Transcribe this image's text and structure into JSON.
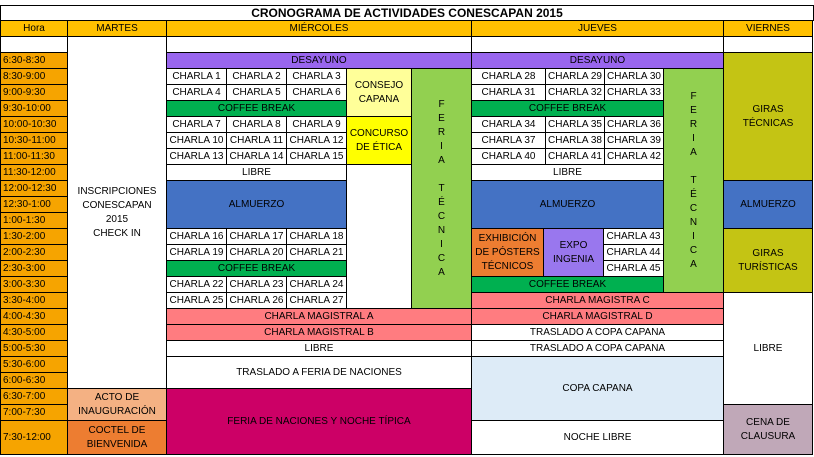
{
  "title": "CRONOGRAMA DE ACTIVIDADES CONESCAPAN 2015",
  "headers": {
    "hora": "Hora",
    "martes": "MARTES",
    "miercoles": "MIÉRCOLES",
    "jueves": "JUEVES",
    "viernes": "VIERNES"
  },
  "hours": [
    "6:30-8:30",
    "8:30-9:00",
    "9:00-9:30",
    "9:30-10:00",
    "10:00-10:30",
    "10:30-11:00",
    "11:00-11:30",
    "11:30-12:00",
    "12:00-12:30",
    "12:30-1:00",
    "1:00-1:30",
    "1:30-2:00",
    "2:00-2:30",
    "2:30-3:00",
    "3:00-3:30",
    "3:30-4:00",
    "4:00-4:30",
    "4:30-5:00",
    "5:00-5:30",
    "5:30-6:00",
    "6:00-6:30",
    "6:30-7:00",
    "7:00-7:30",
    "7:30-12:00"
  ],
  "martes": {
    "inscripciones": "INSCRIPCIONES\nCONESCAPAN\n2015\nCHECK IN",
    "acto": "ACTO DE\nINAUGURACIÓN",
    "coctel": "COCTEL DE\nBIENVENIDA"
  },
  "miercoles": {
    "desayuno": "DESAYUNO",
    "charlas_a": [
      "CHARLA 1",
      "CHARLA 2",
      "CHARLA 3",
      "CHARLA 4",
      "CHARLA 5",
      "CHARLA 6"
    ],
    "coffee1": "COFFEE BREAK",
    "charlas_b": [
      "CHARLA 7",
      "CHARLA 8",
      "CHARLA 9",
      "CHARLA 10",
      "CHARLA 11",
      "CHARLA 12",
      "CHARLA 13",
      "CHARLA 14",
      "CHARLA 15"
    ],
    "consejo": "CONSEJO\nCAPANA",
    "concurso": "CONCURSO\nDE ÉTICA",
    "libre1": "LIBRE",
    "almuerzo": "ALMUERZO",
    "charlas_c": [
      "CHARLA 16",
      "CHARLA 17",
      "CHARLA 18",
      "CHARLA 19",
      "CHARLA 20",
      "CHARLA 21"
    ],
    "coffee2": "COFFEE BREAK",
    "charlas_d": [
      "CHARLA 22",
      "CHARLA 23",
      "CHARLA 24",
      "CHARLA 25",
      "CHARLA 26",
      "CHARLA 27"
    ],
    "feria_tecnica": [
      "F",
      "E",
      "R",
      "I",
      "A",
      "",
      "T",
      "É",
      "C",
      "N",
      "I",
      "C",
      "A"
    ],
    "magistral_a": "CHARLA MAGISTRAL A",
    "magistral_b": "CHARLA MAGISTRAL B",
    "libre2": "LIBRE",
    "traslado": "TRASLADO A FERIA DE NACIONES",
    "feria_noche": "FERIA DE NACIONES Y NOCHE TÍPICA"
  },
  "jueves": {
    "desayuno": "DESAYUNO",
    "charlas_a": [
      "CHARLA 28",
      "CHARLA 29",
      "CHARLA 30",
      "CHARLA 31",
      "CHARLA 32",
      "CHARLA 33"
    ],
    "coffee1": "COFFEE BREAK",
    "charlas_b": [
      "CHARLA 34",
      "CHARLA 35",
      "CHARLA 36",
      "CHARLA 37",
      "CHARLA 38",
      "CHARLA 39",
      "CHARLA 40",
      "CHARLA 41",
      "CHARLA 42"
    ],
    "libre1": "LIBRE",
    "almuerzo": "ALMUERZO",
    "exhibicion": "EXHIBICIÓN\nDE PÓSTERS\nTÉCNICOS",
    "expo": "EXPO\nINGENIA",
    "charlas_c": [
      "CHARLA 43",
      "CHARLA 44",
      "CHARLA 45"
    ],
    "coffee2": "COFFEE BREAK",
    "feria_tecnica": [
      "F",
      "E",
      "R",
      "I",
      "A",
      "",
      "T",
      "É",
      "C",
      "N",
      "I",
      "C",
      "A"
    ],
    "magistral_c": "CHARLA MAGISTRA C",
    "magistral_d": "CHARLA MAGISTRAL D",
    "traslado1": "TRASLADO A COPA CAPANA",
    "traslado2": "TRASLADO A COPA CAPANA",
    "copa": "COPA CAPANA",
    "noche_libre": "NOCHE LIBRE"
  },
  "viernes": {
    "giras_tecnicas": "GIRAS\nTÉCNICAS",
    "almuerzo": "ALMUERZO",
    "giras_turisticas": "GIRAS\nTURÍSTICAS",
    "libre": "LIBRE",
    "cena": "CENA DE\nCLAUSURA"
  },
  "colors": {
    "hour": "#f6a400",
    "header": "#ffc000",
    "purple": "#9966ee",
    "green": "#00b050",
    "blue": "#4472c4",
    "salmon": "#ff7c80",
    "pink": "#cc0066",
    "lightblue": "#ddebf7",
    "peach": "#f4b183",
    "orange": "#ed7d31",
    "olive": "#c4c414",
    "grey": "#c0a8b8",
    "yellow_light": "#ffff99",
    "yellow": "#ffff00",
    "lime": "#92d050",
    "lavender": "#9977ee"
  }
}
